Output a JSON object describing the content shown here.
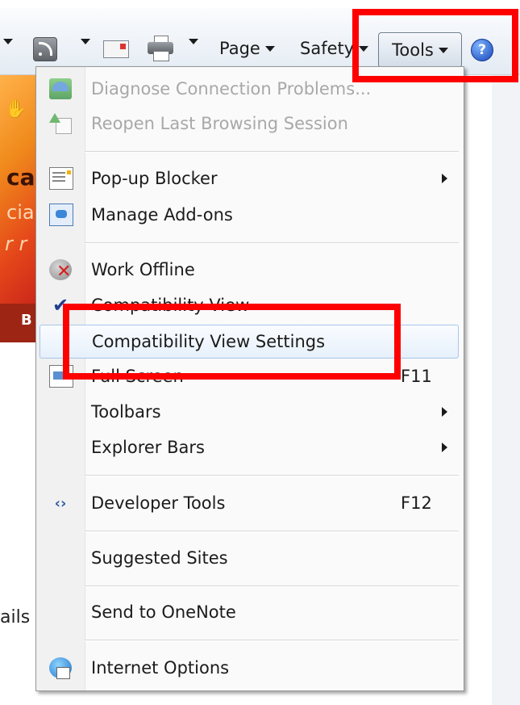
{
  "toolbar": {
    "page_label": "Page",
    "safety_label": "Safety",
    "tools_label": "Tools",
    "help_label": "?",
    "icons": [
      "rss-feed-icon",
      "read-mail-icon",
      "print-icon",
      "help-icon"
    ]
  },
  "page": {
    "banner_glyph": "✋",
    "banner_line1": "ca",
    "banner_line2": "cia",
    "banner_line3": "r r",
    "banner_bar": "B",
    "snippet": "ails"
  },
  "menu": {
    "items": [
      {
        "label": "Diagnose Connection Problems...",
        "enabled": false,
        "icon": "diagnose-icon"
      },
      {
        "label": "Reopen Last Browsing Session",
        "enabled": false,
        "icon": "reopen-session-icon"
      },
      {
        "label": "Pop-up Blocker",
        "submenu": true,
        "icon": "popup-blocker-icon"
      },
      {
        "label": "Manage Add-ons",
        "icon": "manage-addons-icon"
      },
      {
        "label": "Work Offline",
        "icon": "work-offline-icon"
      },
      {
        "label": "Compatibility View",
        "checked": true,
        "icon": "checkmark-icon"
      },
      {
        "label": "Compatibility View Settings",
        "highlighted": true
      },
      {
        "label": "Full Screen",
        "shortcut": "F11",
        "icon": "full-screen-icon"
      },
      {
        "label": "Toolbars",
        "submenu": true
      },
      {
        "label": "Explorer Bars",
        "submenu": true
      },
      {
        "label": "Developer Tools",
        "shortcut": "F12",
        "icon": "developer-tools-icon"
      },
      {
        "label": "Suggested Sites"
      },
      {
        "label": "Send to OneNote"
      },
      {
        "label": "Internet Options",
        "icon": "internet-options-icon"
      }
    ]
  },
  "colors": {
    "highlight_box": "#ff0000",
    "menu_hover": "#e6f0fb",
    "disabled_text": "#a8a8a8"
  }
}
